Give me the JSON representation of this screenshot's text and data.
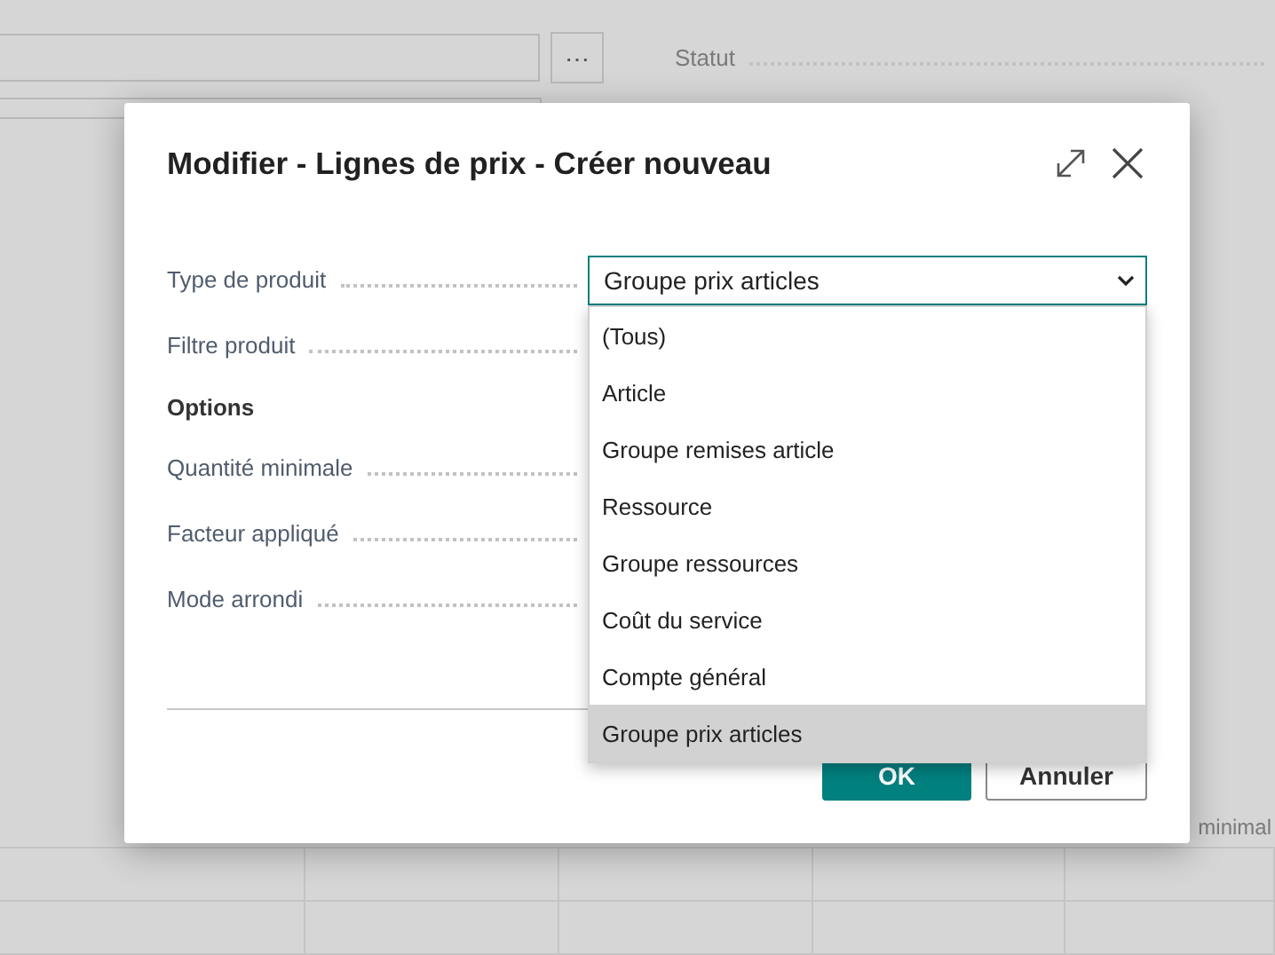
{
  "background": {
    "ellipsis_button": "⋯",
    "statut_label": "Statut",
    "partial_label": "minimal"
  },
  "dialog": {
    "title": "Modifier - Lignes de prix - Créer nouveau",
    "fields": [
      {
        "kind": "select",
        "label": "Type de produit",
        "value": "Groupe prix articles"
      },
      {
        "kind": "field",
        "label": "Filtre produit"
      },
      {
        "kind": "heading",
        "label": "Options"
      },
      {
        "kind": "field",
        "label": "Quantité minimale"
      },
      {
        "kind": "field",
        "label": "Facteur appliqué"
      },
      {
        "kind": "field",
        "label": "Mode arrondi"
      }
    ],
    "dropdown": {
      "options": [
        {
          "label": "(Tous)",
          "selected": false
        },
        {
          "label": "Article",
          "selected": false
        },
        {
          "label": "Groupe remises article",
          "selected": false
        },
        {
          "label": "Ressource",
          "selected": false
        },
        {
          "label": "Groupe ressources",
          "selected": false
        },
        {
          "label": "Coût du service",
          "selected": false
        },
        {
          "label": "Compte général",
          "selected": false
        },
        {
          "label": "Groupe prix articles",
          "selected": true
        }
      ]
    },
    "buttons": [
      {
        "label": "OK",
        "kind": "primary"
      },
      {
        "label": "Annuler",
        "kind": "secondary"
      }
    ]
  }
}
